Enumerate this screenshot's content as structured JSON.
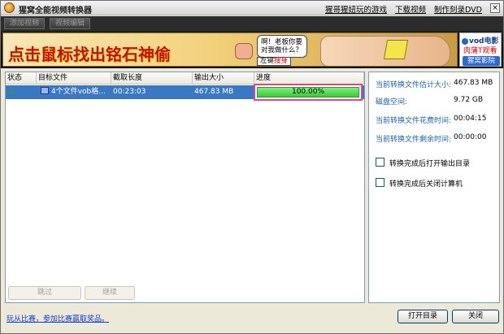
{
  "app": {
    "title": "猩窝全能视频转换器",
    "top_links": [
      "猩哥猩妞玩的游戏",
      "下载视频",
      "制作刻录DVD"
    ],
    "close_label": "×"
  },
  "toolbar": {
    "buttons": [
      "添加视频",
      "视频编辑"
    ]
  },
  "banner": {
    "slogan": "点击鼠标找出铭石神偷",
    "bubble_line1": "啊！老板你要",
    "bubble_line2": "对我做什么？",
    "tag_prefix": "左键",
    "tag_highlight": "搜身"
  },
  "vod": {
    "logo": "vod电影",
    "tagline": "肉蒲T观看",
    "button": "猩窝影院"
  },
  "table": {
    "columns": [
      "状态",
      "目标文件",
      "截取长度",
      "输出大小",
      "进度"
    ],
    "rows": [
      {
        "status_icon": "✔",
        "target": "4个文件vob格...",
        "length": "00:23:03",
        "size": "467.83 MB",
        "progress_text": "100.00%",
        "progress_value": 100
      }
    ]
  },
  "actions": {
    "skip": "跳过",
    "continue": "继续",
    "open_dir": "打开目录",
    "close": "关闭"
  },
  "info": {
    "est_size_label": "当前转换文件估计大小:",
    "est_size_value": "467.83 MB",
    "disk_label": "磁盘空间:",
    "disk_value": "9.72 GB",
    "time_used_label": "当前转换文件花费时间:",
    "time_used_value": "00:04:15",
    "time_left_label": "当前转换文件剩余时间:",
    "time_left_value": "00:00:00",
    "option_open_dir": "转换完成后打开输出目录",
    "option_shutdown": "转换完成后关闭计算机"
  },
  "footer": {
    "promo_link": "玩从比赛，参加比赛赢取奖品。"
  },
  "colors": {
    "selection": "#3a78c3",
    "progress_fill": "#3cc83c",
    "progress_border_highlight": "#e0429a",
    "info_label": "#1e5fb0"
  }
}
